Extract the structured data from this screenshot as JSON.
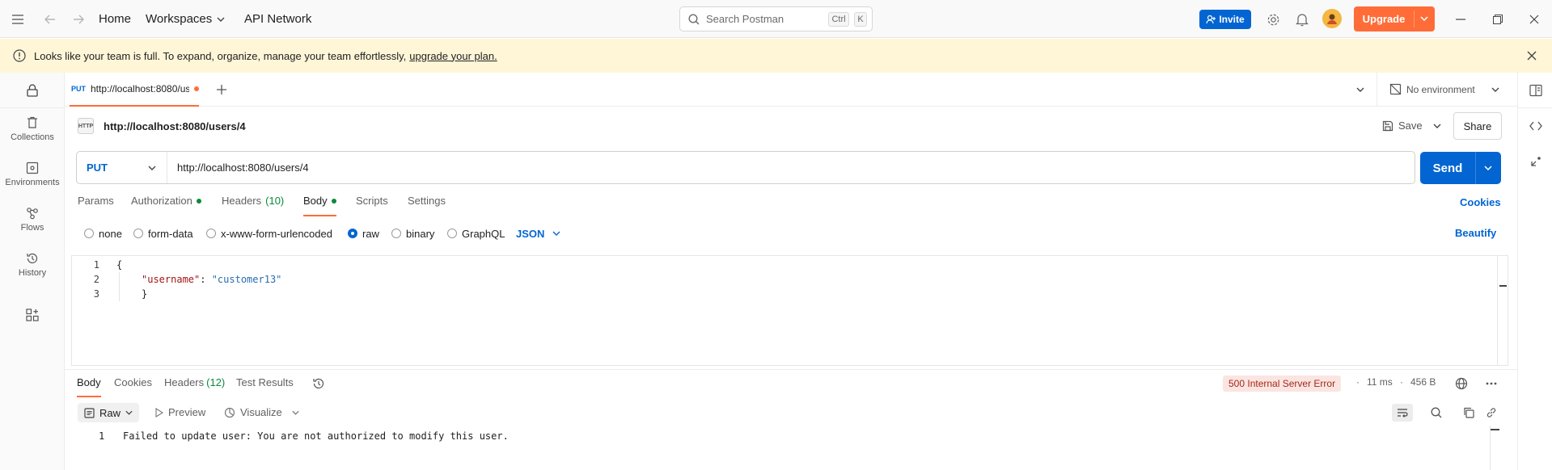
{
  "titlebar": {
    "home": "Home",
    "workspaces": "Workspaces",
    "api_network": "API Network",
    "search_placeholder": "Search Postman",
    "kbd_ctrl": "Ctrl",
    "kbd_k": "K",
    "invite": "Invite",
    "upgrade": "Upgrade"
  },
  "banner": {
    "text": "Looks like your team is full. To expand, organize, manage your team effortlessly,",
    "link": "upgrade your plan."
  },
  "sidebar": {
    "items": [
      {
        "label": "Collections",
        "icon": "trash-bin-icon"
      },
      {
        "label": "Environments",
        "icon": "environment-icon"
      },
      {
        "label": "Flows",
        "icon": "flows-icon"
      },
      {
        "label": "History",
        "icon": "history-icon"
      }
    ]
  },
  "tabs": {
    "active": {
      "method": "PUT",
      "title": "http://localhost:8080/us"
    },
    "environment": "No environment"
  },
  "request": {
    "name": "http://localhost:8080/users/4",
    "save": "Save",
    "share": "Share",
    "method": "PUT",
    "url": "http://localhost:8080/users/4",
    "send": "Send",
    "tabs": [
      {
        "label": "Params"
      },
      {
        "label": "Authorization"
      },
      {
        "label": "Headers",
        "count": "(10)"
      },
      {
        "label": "Body"
      },
      {
        "label": "Scripts"
      },
      {
        "label": "Settings"
      }
    ],
    "cookies": "Cookies",
    "body_types": [
      "none",
      "form-data",
      "x-www-form-urlencoded",
      "raw",
      "binary",
      "GraphQL"
    ],
    "selected_body_type": "raw",
    "format": "JSON",
    "beautify": "Beautify",
    "code_lines": [
      {
        "n": "1",
        "text": "{"
      },
      {
        "n": "2",
        "key": "\"username\"",
        "sep": ": ",
        "value": "\"customer13\""
      },
      {
        "n": "3",
        "text": "}"
      }
    ]
  },
  "response": {
    "tabs": [
      {
        "label": "Body"
      },
      {
        "label": "Cookies"
      },
      {
        "label": "Headers",
        "count": "(12)"
      },
      {
        "label": "Test Results"
      }
    ],
    "status": "500 Internal Server Error",
    "time": "11 ms",
    "size": "456 B",
    "view_raw": "Raw",
    "preview": "Preview",
    "visualize": "Visualize",
    "line_no": "1",
    "line_text": "Failed to update user: You are not authorized to modify this user."
  },
  "colors": {
    "accent": "#ff6c37",
    "primary": "#0265d2",
    "status_dot": "#0b8a3d",
    "error_bg": "#fbe5e1"
  }
}
